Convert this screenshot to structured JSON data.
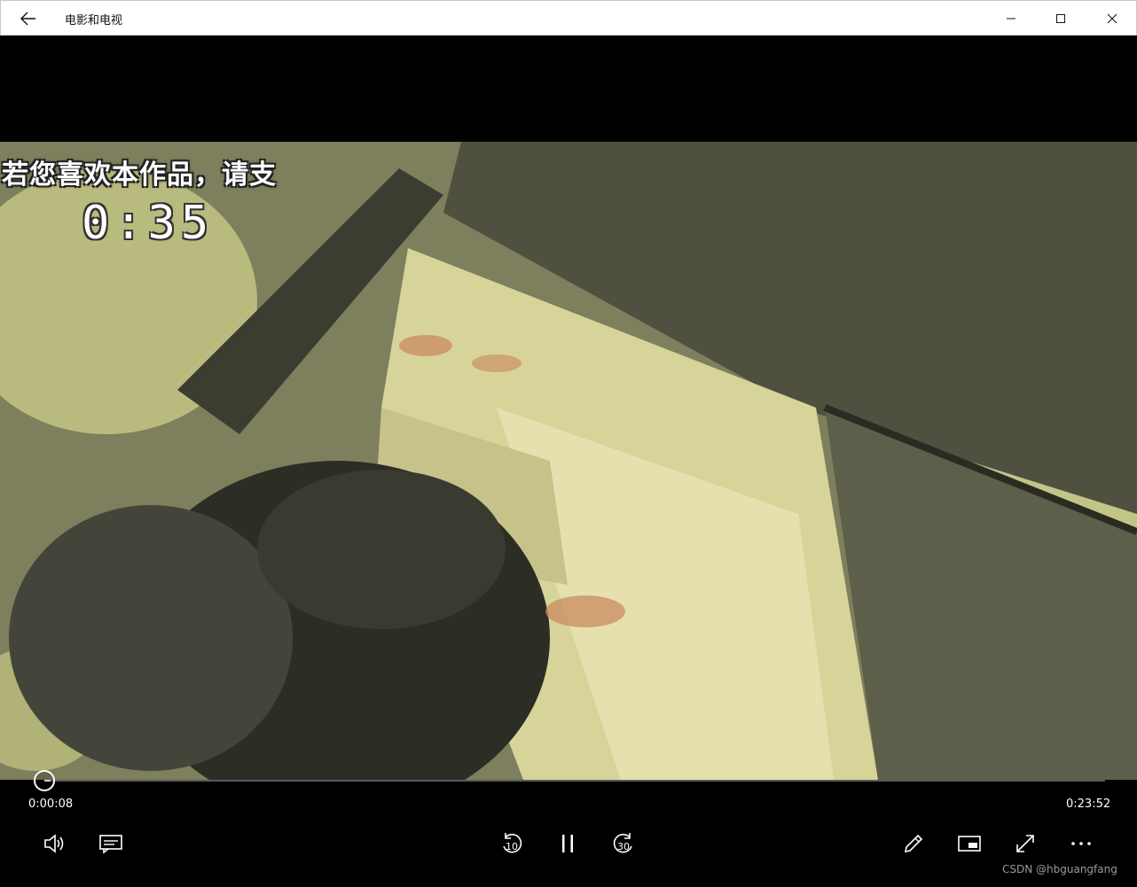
{
  "window": {
    "title": "电影和电视",
    "back_icon": "arrow-left-icon",
    "minimize_icon": "minimize-icon",
    "maximize_icon": "maximize-icon",
    "close_icon": "close-icon"
  },
  "video": {
    "overlay_text": "若您喜欢本作品，请支",
    "overlay_timer": "0:35"
  },
  "playback": {
    "current_time": "0:00:08",
    "total_time": "0:23:52",
    "progress_fraction": 0.0056
  },
  "controls": {
    "skip_back_seconds": "10",
    "skip_forward_seconds": "30",
    "icons": [
      "volume-icon",
      "subtitles-icon",
      "skip-back-icon",
      "pause-icon",
      "skip-forward-icon",
      "edit-pen-icon",
      "mini-view-icon",
      "fullscreen-icon",
      "more-icon"
    ]
  },
  "watermark": "CSDN @hbguangfang"
}
